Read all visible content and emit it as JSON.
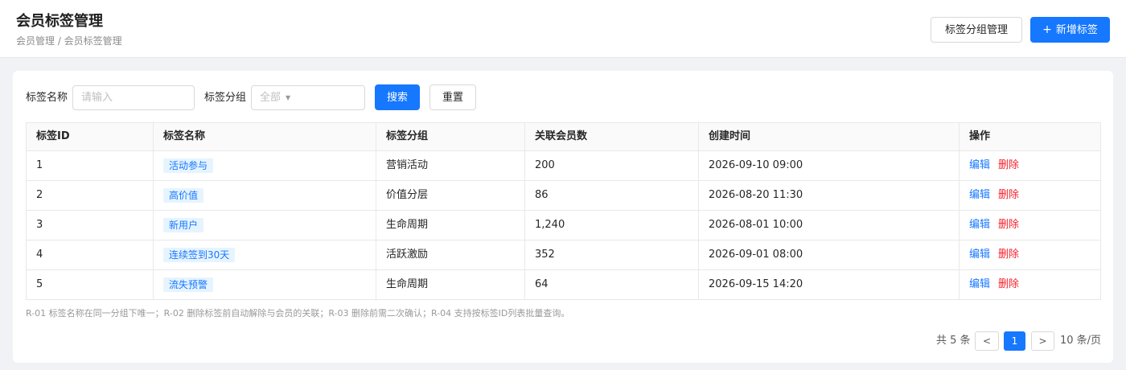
{
  "header": {
    "title": "会员标签管理",
    "breadcrumb": "会员管理 / 会员标签管理",
    "group_manage_label": "标签分组管理",
    "add_plus": "+",
    "add_label": "新增标签"
  },
  "filters": {
    "name_label": "标签名称",
    "name_placeholder": "请输入",
    "group_label": "标签分组",
    "group_value": "全部",
    "search_label": "搜索",
    "reset_label": "重置"
  },
  "table": {
    "columns": [
      "标签ID",
      "标签名称",
      "标签分组",
      "关联会员数",
      "创建时间",
      "操作"
    ],
    "rows": [
      {
        "id": "1",
        "name": "活动参与",
        "group": "营销活动",
        "members": "200",
        "created": "2026-09-10 09:00",
        "edit": "编辑",
        "delete": "删除"
      },
      {
        "id": "2",
        "name": "高价值",
        "group": "价值分层",
        "members": "86",
        "created": "2026-08-20 11:30",
        "edit": "编辑",
        "delete": "删除"
      },
      {
        "id": "3",
        "name": "新用户",
        "group": "生命周期",
        "members": "1,240",
        "created": "2026-08-01 10:00",
        "edit": "编辑",
        "delete": "删除"
      },
      {
        "id": "4",
        "name": "连续签到30天",
        "group": "活跃激励",
        "members": "352",
        "created": "2026-09-01 08:00",
        "edit": "编辑",
        "delete": "删除"
      },
      {
        "id": "5",
        "name": "流失预警",
        "group": "生命周期",
        "members": "64",
        "created": "2026-09-15 14:20",
        "edit": "编辑",
        "delete": "删除"
      }
    ]
  },
  "note": "R-01 标签名称在同一分组下唯一；R-02 删除标签前自动解除与会员的关联；R-03 删除前需二次确认；R-04 支持按标签ID列表批量查询。",
  "pagination": {
    "total": "共 5 条",
    "prev": "<",
    "current": "1",
    "next": ">",
    "page_size": "10 条/页"
  },
  "colors": {
    "primary": "#1677ff",
    "danger": "#f5222d",
    "tag_bg": "#e6f4ff"
  }
}
